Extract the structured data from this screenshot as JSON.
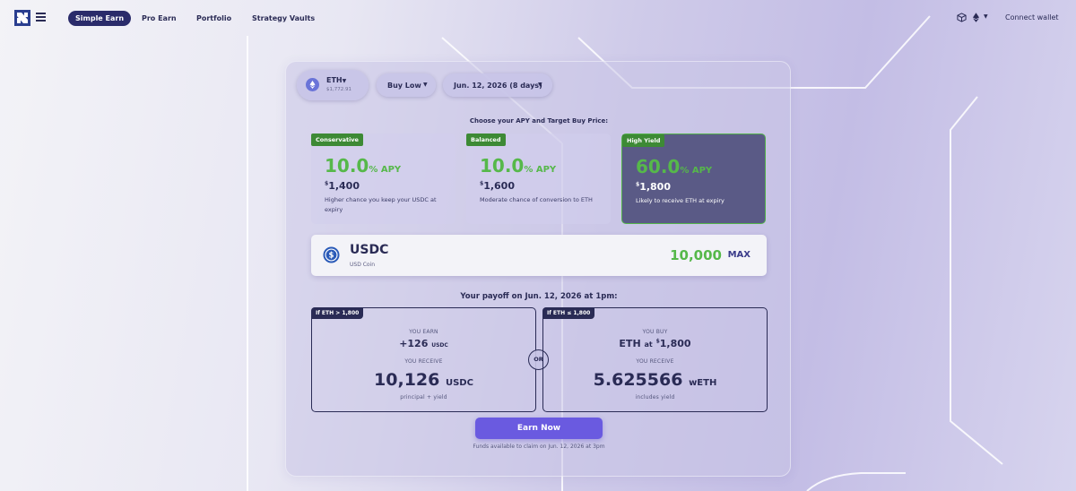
{
  "nav": {
    "items": [
      "Simple Earn",
      "Pro Earn",
      "Portfolio",
      "Strategy Vaults"
    ],
    "connect_wallet": "Connect wallet"
  },
  "asset": {
    "symbol": "ETH",
    "price": "$1,772.91"
  },
  "strategy": {
    "label": "Buy Low"
  },
  "expiry": {
    "label": "Jun. 12, 2026 (8 days)"
  },
  "choose_label": "Choose your APY and Target Buy Price:",
  "options": [
    {
      "tag": "Conservative",
      "apy": "10.0",
      "apy_suffix": "% APY",
      "price": "1,400",
      "desc": "Higher chance you keep your USDC at expiry",
      "selected": false
    },
    {
      "tag": "Balanced",
      "apy": "10.0",
      "apy_suffix": "% APY",
      "price": "1,600",
      "desc": "Moderate chance of conversion to ETH",
      "selected": false
    },
    {
      "tag": "High Yield",
      "apy": "60.0",
      "apy_suffix": "% APY",
      "price": "1,800",
      "desc": "Likely to receive ETH at expiry",
      "selected": true
    }
  ],
  "deposit": {
    "token": "USDC",
    "token_name": "USD Coin",
    "amount": "10,000",
    "max_label": "MAX"
  },
  "payoff": {
    "title": "Your payoff on Jun. 12, 2026 at 1pm:",
    "or_label": "OR",
    "up": {
      "tag": "If ETH > 1,800",
      "earn_label": "YOU EARN",
      "earn_value": "+126",
      "earn_unit": "USDC",
      "receive_label": "YOU RECEIVE",
      "receive_value": "10,126",
      "receive_unit": "USDC",
      "note": "principal + yield"
    },
    "down": {
      "tag": "If ETH ≤ 1,800",
      "buy_label": "YOU BUY",
      "buy_value_prefix": "ETH",
      "buy_at": "at",
      "buy_price": "1,800",
      "receive_label": "YOU RECEIVE",
      "receive_value": "5.625566",
      "receive_unit": "wETH",
      "note": "includes yield"
    }
  },
  "cta": {
    "label": "Earn Now"
  },
  "claim_note": "Funds available to claim on Jun. 12, 2026 at 3pm",
  "colors": {
    "accent": "#6a5ae0",
    "green": "#56b84a",
    "navy": "#2a2b6a"
  }
}
